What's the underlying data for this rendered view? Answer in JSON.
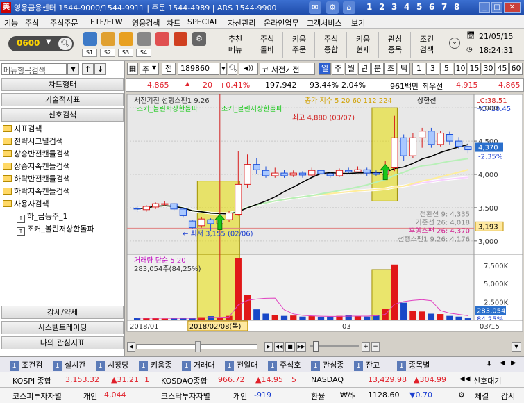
{
  "titlebar": {
    "logo": "美",
    "title": "영웅금융센터 1544-9000/1544-9911 | 주문 1544-4989 | ARS 1544-9900",
    "screens": [
      "1",
      "2",
      "3",
      "4",
      "5",
      "6",
      "7",
      "8"
    ]
  },
  "menu": [
    "기능",
    "주식",
    "주식주문",
    "ETF/ELW",
    "영웅검색",
    "차트",
    "SPECIAL",
    "자산관리",
    "온라인업무",
    "고객서비스",
    "보기"
  ],
  "toolbar": {
    "screen_no": "0600",
    "slots": [
      "S1",
      "S2",
      "S3",
      "S4"
    ],
    "buttons": [
      {
        "l1": "추천",
        "l2": "메뉴"
      },
      {
        "l1": "주식",
        "l2": "돌바"
      },
      {
        "l1": "키움",
        "l2": "주문"
      },
      {
        "l1": "주식",
        "l2": "종합"
      },
      {
        "l1": "키움",
        "l2": "현재"
      },
      {
        "l1": "관심",
        "l2": "종목"
      },
      {
        "l1": "조건",
        "l2": "검색"
      }
    ],
    "date": "21/05/15",
    "time": "18:24:31"
  },
  "left": {
    "search_placeholder": "메뉴항목검색",
    "headers": [
      "차트형태",
      "기술적지표",
      "신호검색"
    ],
    "tree": [
      "지표검색",
      "전략시그널검색",
      "상승반전캔들검색",
      "상승지속캔들검색",
      "하락반전캔들검색",
      "하락지속캔들검색",
      "사용자검색",
      "하_급등주_1",
      "조커_볼린저상한돌파"
    ],
    "bottom_headers": [
      "강세/약세",
      "시스템트레이딩",
      "나의 관심지표"
    ]
  },
  "chart": {
    "market": "주",
    "market2": "전",
    "code": "189860",
    "name": "서전기전",
    "name_prefix": "코",
    "periods": [
      "일",
      "주",
      "월",
      "년",
      "분",
      "초",
      "틱"
    ],
    "period_selected": "일",
    "minutes": [
      "1",
      "3",
      "5",
      "10",
      "15",
      "30",
      "45",
      "60"
    ],
    "quote": {
      "price": "4,865",
      "change": "20",
      "change_pct": "+0.41%",
      "volume": "197,942",
      "vol_ratio": "93.44%",
      "turnover": "2.04%",
      "amount": "961백만",
      "low_label": "최우선",
      "low": "4,915",
      "high": "4,865"
    },
    "legend_price": "서전기전 선행스팬1 9.26",
    "signal_label": "조커_볼린저상한돌파",
    "signal_label2": "조커_볼린저상한돌파",
    "legend_right": "종가 지수 5 20 60 112 224",
    "legend_upper": "상한선",
    "lc": "LC:38.51",
    "hc": "HC:-10.45",
    "max_label": "최고 4,880 (03/07)",
    "min_label": "최저 3,155 (02/06)",
    "price_axis": [
      "5,000",
      "4,500",
      "4,000",
      "3,500",
      "3,000"
    ],
    "cur_price_box": "4,370",
    "cur_pct_box": "-2.35%",
    "low_box": "3,193",
    "right_labels": [
      "전환선 9: 4,335",
      "기준선 26: 4,018",
      "후행스팬 26: 4,370",
      "선행스팬1 9.26: 4,176"
    ],
    "vol_legend1": "거래량 단순 5 20",
    "vol_legend2": "283,054주(84,25%)",
    "vol_axis": [
      "7,500K",
      "5,000K",
      "2,500K"
    ],
    "vol_box": "283,054",
    "vol_pct_box": "84.25%",
    "x_labels": [
      "2018/01",
      "03",
      "03/15"
    ],
    "cursor_date": "2018/02/08(목)"
  },
  "chart_data": {
    "type": "candlestick",
    "price_ylim": [
      2800,
      5200
    ],
    "volume_ylim": [
      0,
      9000
    ],
    "candles": [
      {
        "o": 3490,
        "c": 3480,
        "h": 3520,
        "l": 3440
      },
      {
        "o": 3470,
        "c": 3520,
        "h": 3540,
        "l": 3440
      },
      {
        "o": 3510,
        "c": 3560,
        "h": 3580,
        "l": 3480
      },
      {
        "o": 3560,
        "c": 3560,
        "h": 3600,
        "l": 3520
      },
      {
        "o": 3560,
        "c": 3480,
        "h": 3570,
        "l": 3460
      },
      {
        "o": 3480,
        "c": 3380,
        "h": 3490,
        "l": 3350
      },
      {
        "o": 3300,
        "c": 3200,
        "h": 3320,
        "l": 3180
      },
      {
        "o": 3230,
        "c": 3330,
        "h": 3360,
        "l": 3200
      },
      {
        "o": 3320,
        "c": 3260,
        "h": 3340,
        "l": 3155
      },
      {
        "o": 3260,
        "c": 3350,
        "h": 3390,
        "l": 3230
      },
      {
        "o": 3320,
        "c": 3420,
        "h": 3450,
        "l": 3280
      },
      {
        "o": 3400,
        "c": 3850,
        "h": 4350,
        "l": 3380
      },
      {
        "o": 3850,
        "c": 4150,
        "h": 4300,
        "l": 3800
      },
      {
        "o": 4150,
        "c": 4070,
        "h": 4250,
        "l": 4000
      },
      {
        "o": 4060,
        "c": 3980,
        "h": 4120,
        "l": 3950
      },
      {
        "o": 3980,
        "c": 4020,
        "h": 4100,
        "l": 3950
      },
      {
        "o": 4020,
        "c": 3980,
        "h": 4070,
        "l": 3950
      },
      {
        "o": 3990,
        "c": 4020,
        "h": 4060,
        "l": 3960
      },
      {
        "o": 4020,
        "c": 3990,
        "h": 4050,
        "l": 3950
      },
      {
        "o": 3990,
        "c": 4060,
        "h": 4100,
        "l": 3970
      },
      {
        "o": 4060,
        "c": 4010,
        "h": 4120,
        "l": 4000
      },
      {
        "o": 4010,
        "c": 3980,
        "h": 4040,
        "l": 3950
      },
      {
        "o": 3980,
        "c": 4060,
        "h": 4090,
        "l": 3960
      },
      {
        "o": 4060,
        "c": 4040,
        "h": 4100,
        "l": 4020
      },
      {
        "o": 4040,
        "c": 4070,
        "h": 4120,
        "l": 4030
      },
      {
        "o": 4070,
        "c": 4020,
        "h": 4100,
        "l": 3980
      },
      {
        "o": 4020,
        "c": 4000,
        "h": 4060,
        "l": 3970
      },
      {
        "o": 4000,
        "c": 4100,
        "h": 4200,
        "l": 3980
      },
      {
        "o": 4100,
        "c": 4550,
        "h": 4880,
        "l": 4050
      },
      {
        "o": 4550,
        "c": 4280,
        "h": 4600,
        "l": 4200
      },
      {
        "o": 4280,
        "c": 4550,
        "h": 4620,
        "l": 4250
      },
      {
        "o": 4550,
        "c": 4650,
        "h": 4700,
        "l": 4400
      },
      {
        "o": 4650,
        "c": 4450,
        "h": 4700,
        "l": 4400
      },
      {
        "o": 4450,
        "c": 4620,
        "h": 4650,
        "l": 4420
      },
      {
        "o": 4600,
        "c": 4500,
        "h": 4640,
        "l": 4450
      },
      {
        "o": 4500,
        "c": 4420,
        "h": 4560,
        "l": 4380
      },
      {
        "o": 4420,
        "c": 4370,
        "h": 4470,
        "l": 4320
      }
    ],
    "volume": [
      320,
      280,
      300,
      220,
      250,
      380,
      300,
      420,
      560,
      380,
      600,
      8500,
      3500,
      1500,
      900,
      700,
      600,
      650,
      500,
      560,
      480,
      500,
      600,
      700,
      550,
      500,
      700,
      1600,
      7600,
      2400,
      1300,
      1200,
      900,
      850,
      600,
      500,
      280
    ]
  },
  "bottom": {
    "tabs": [
      "조건검",
      "실시간",
      "시장당",
      "키움종",
      "거래대",
      "전일대",
      "주식호",
      "관심종",
      "잔고",
      "종목별"
    ],
    "row2": {
      "kospi_label": "KOSPI 종합",
      "kospi": "3,153.32",
      "kospi_chg": "▲31.21",
      "kospi_x": "1",
      "kosdaq_label": "KOSDAQ종합",
      "kosdaq": "966.72",
      "kosdaq_chg": "▲14.95",
      "kosdaq_x": "5",
      "nasdaq_label": "NASDAQ",
      "nasdaq": "13,429.98",
      "nasdaq_chg": "▲304.99",
      "signal": "신호대기"
    },
    "row3": {
      "kospi_inv": "코스피투자자별",
      "ind1": "개인",
      "ind1_val": "4,044",
      "kosdaq_inv": "코스닥투자자별",
      "ind2": "개인",
      "ind2_val": "-919",
      "fx_label": "환율",
      "fx_sym": "₩/$",
      "fx": "1128.60",
      "fx_chg": "▼0.70",
      "exec": "체결",
      "watch": "감시"
    }
  }
}
